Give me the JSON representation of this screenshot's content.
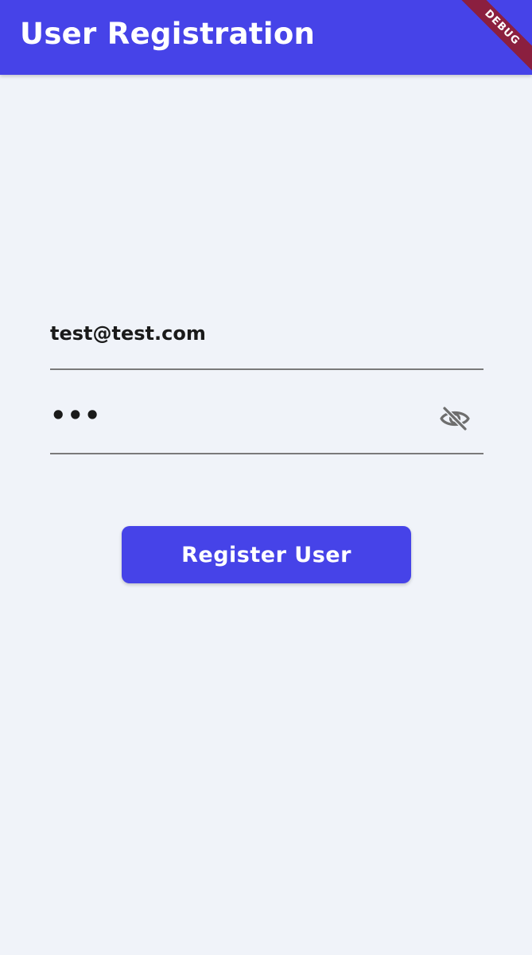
{
  "app_bar": {
    "title": "User Registration",
    "background_color": "#4643e8"
  },
  "debug_banner": {
    "label": "DEBUG",
    "color": "#8b1f3f"
  },
  "form": {
    "email": {
      "value": "test@test.com"
    },
    "password": {
      "masked_value": "•••",
      "visibility_icon": "visibility-off-icon"
    },
    "submit": {
      "label": "Register User",
      "color": "#4643e8"
    }
  },
  "colors": {
    "background": "#f0f3f9",
    "field_underline": "#7a7a7a",
    "text": "#1a1a1a"
  }
}
